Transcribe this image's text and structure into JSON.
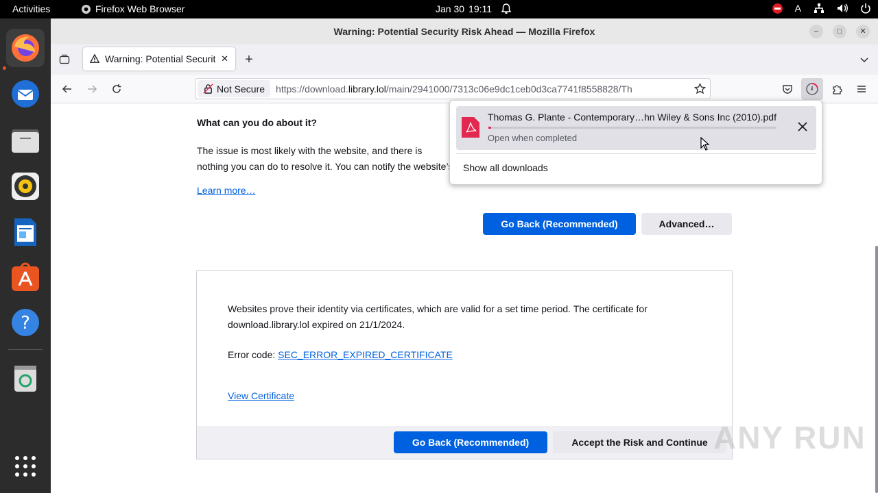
{
  "topbar": {
    "activities": "Activities",
    "app_name": "Firefox Web Browser",
    "date": "Jan 30",
    "time": "19:11",
    "input_indicator": "A"
  },
  "window": {
    "title": "Warning: Potential Security Risk Ahead — Mozilla Firefox"
  },
  "tabs": [
    {
      "label": "Warning: Potential Security Risk Ahead"
    }
  ],
  "navbar": {
    "not_secure_label": "Not Secure",
    "url_prefix": "https://download.",
    "url_domain": "library.lol",
    "url_path": "/main/2941000/7313c06e9dc1ceb0d3ca7741f8558828/Th"
  },
  "page": {
    "heading": "What can you do about it?",
    "paragraph": "The issue is most likely with the website, and there is nothing you can do to resolve it. You can notify the website’s administrator about the problem.",
    "learn_more": "Learn more…",
    "go_back_label": "Go Back (Recommended)",
    "advanced_label": "Advanced…",
    "advanced_text": "Websites prove their identity via certificates, which are valid for a set time period. The certificate for download.library.lol expired on 21/1/2024.",
    "error_code_label": "Error code: ",
    "error_code": "SEC_ERROR_EXPIRED_CERTIFICATE",
    "view_certificate": "View Certificate",
    "go_back_label_2": "Go Back (Recommended)",
    "accept_risk_label": "Accept the Risk and Continue"
  },
  "downloads": {
    "file_name": "Thomas G. Plante - Contemporary…hn Wiley & Sons Inc (2010).pdf",
    "status": "Open when completed",
    "progress": 0.01,
    "show_all": "Show all downloads"
  },
  "watermark": "ANY RUN",
  "colors": {
    "accent": "#0061e0",
    "link": "#0060df",
    "ubuntu_orange": "#e95420"
  }
}
